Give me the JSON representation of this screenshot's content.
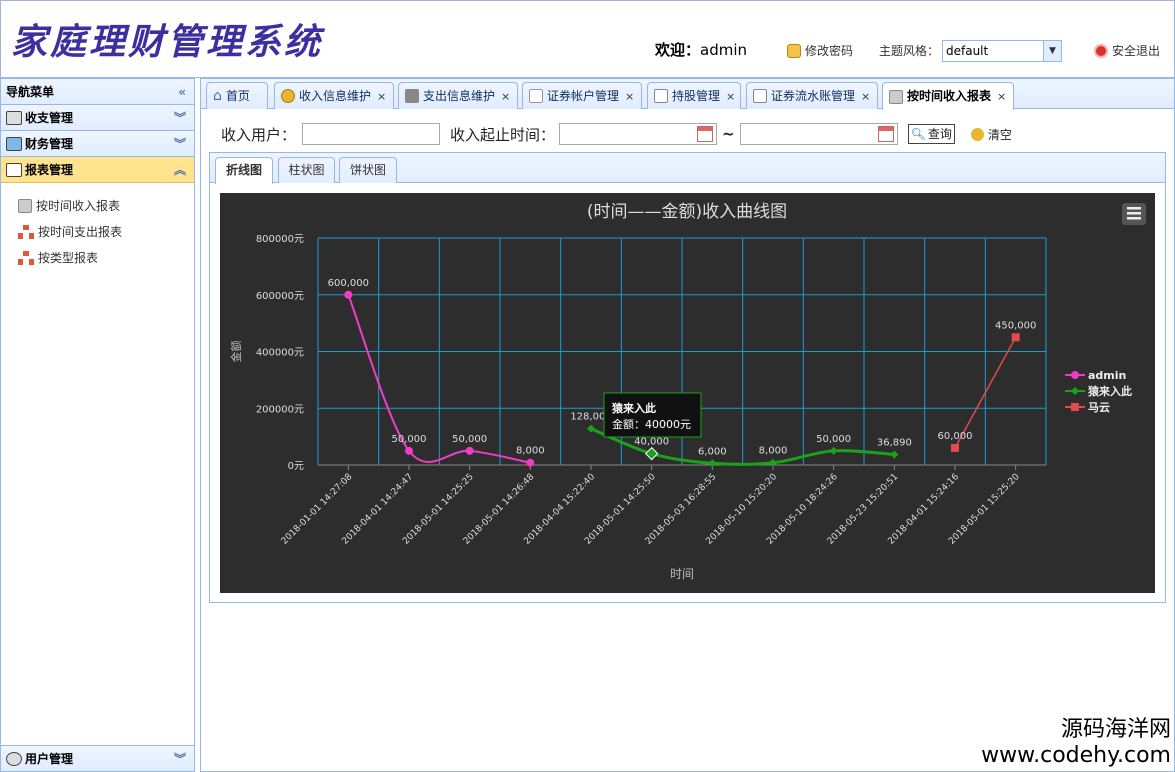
{
  "header": {
    "title": "家庭理财管理系统",
    "welcome_label": "欢迎：",
    "username": "admin",
    "change_password": "修改密码",
    "theme_label": "主题风格：",
    "theme_value": "default",
    "logout": "安全退出"
  },
  "sidebar": {
    "title": "导航菜单",
    "groups": [
      {
        "label": "收支管理"
      },
      {
        "label": "财务管理"
      },
      {
        "label": "报表管理"
      },
      {
        "label": "用户管理"
      }
    ],
    "items": [
      {
        "label": "按时间收入报表"
      },
      {
        "label": "按时间支出报表"
      },
      {
        "label": "按类型报表"
      }
    ]
  },
  "tabs": [
    {
      "label": "首页"
    },
    {
      "label": "收入信息维护"
    },
    {
      "label": "支出信息维护"
    },
    {
      "label": "证券帐户管理"
    },
    {
      "label": "持股管理"
    },
    {
      "label": "证券流水账管理"
    },
    {
      "label": "按时间收入报表"
    }
  ],
  "search": {
    "user_label": "收入用户：",
    "user_value": "",
    "date_label": "收入起止时间：",
    "start_value": "",
    "end_value": "",
    "tilde": "~",
    "query_button": "查询",
    "clear_button": "清空"
  },
  "chart_tabs": [
    {
      "label": "折线图"
    },
    {
      "label": "柱状图"
    },
    {
      "label": "饼状图"
    }
  ],
  "tooltip": {
    "title": "猿来入此",
    "text": "金额：40000元"
  },
  "watermark": {
    "line1": "源码海洋网",
    "line2": "www.codehy.com"
  },
  "colors": {
    "admin": "#f03cc7",
    "monkey": "#1aa31a",
    "mayun": "#e5484d",
    "grid": "#1d9bd8"
  },
  "chart_data": {
    "type": "line",
    "title": "(时间——金额)收入曲线图",
    "xlabel": "时间",
    "ylabel": "金额",
    "categories": [
      "2018-01-01 14:27:08",
      "2018-04-01 14:24:47",
      "2018-05-01 14:25:25",
      "2018-05-01 14:26:48",
      "2018-04-04 15:22:40",
      "2018-05-01 14:25:50",
      "2018-05-03 16:28:55",
      "2018-05-10 15:20:20",
      "2018-05-10 18:24:26",
      "2018-05-23 15:20:51",
      "2018-04-01 15:24:16",
      "2018-05-01 15:25:20"
    ],
    "yticks": [
      "0元",
      "200000元",
      "400000元",
      "600000元",
      "800000元"
    ],
    "ylim": [
      0,
      800000
    ],
    "grid": true,
    "legend": "right",
    "series": [
      {
        "name": "admin",
        "start": 0,
        "values": [
          600000,
          50000,
          50000,
          8000
        ],
        "labels": [
          "600,000",
          "50,000",
          "50,000",
          "8,000"
        ]
      },
      {
        "name": "猿来入此",
        "start": 4,
        "values": [
          128000,
          40000,
          6000,
          8000,
          50000,
          36890
        ],
        "labels": [
          "128,000",
          "40,000",
          "6,000",
          "8,000",
          "50,000",
          "36,890"
        ]
      },
      {
        "name": "马云",
        "start": 10,
        "values": [
          60000,
          450000
        ],
        "labels": [
          "60,000",
          "450,000"
        ]
      }
    ]
  }
}
